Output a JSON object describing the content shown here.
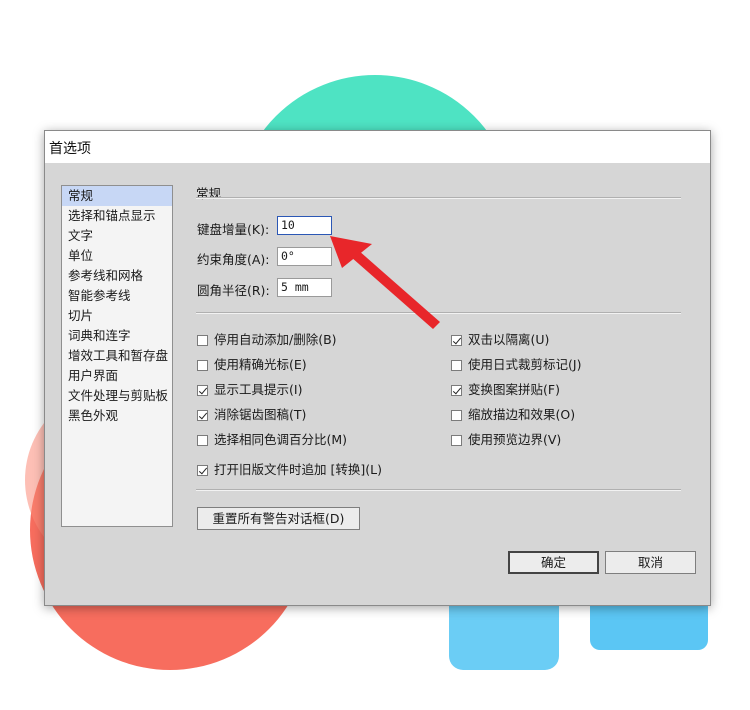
{
  "window": {
    "title": "首选项"
  },
  "sidebar": {
    "items": [
      {
        "label": "常规",
        "selected": true
      },
      {
        "label": "选择和锚点显示"
      },
      {
        "label": "文字"
      },
      {
        "label": "单位"
      },
      {
        "label": "参考线和网格"
      },
      {
        "label": "智能参考线"
      },
      {
        "label": "切片"
      },
      {
        "label": "词典和连字"
      },
      {
        "label": "增效工具和暂存盘"
      },
      {
        "label": "用户界面"
      },
      {
        "label": "文件处理与剪贴板"
      },
      {
        "label": "黑色外观"
      }
    ]
  },
  "general": {
    "section_title": "常规",
    "keyboard_increment": {
      "label": "键盘增量(K):",
      "value": "10"
    },
    "constrain_angle": {
      "label": "约束角度(A):",
      "value": "0°"
    },
    "corner_radius": {
      "label": "圆角半径(R):",
      "value": "5 mm"
    }
  },
  "options": {
    "disable_auto_add_delete": {
      "label": "停用自动添加/删除(B)",
      "checked": false
    },
    "double_click_isolate": {
      "label": "双击以隔离(U)",
      "checked": true
    },
    "precise_cursors": {
      "label": "使用精确光标(E)",
      "checked": false
    },
    "japanese_crop_marks": {
      "label": "使用日式裁剪标记(J)",
      "checked": false
    },
    "show_tooltips": {
      "label": "显示工具提示(I)",
      "checked": true
    },
    "transform_pattern_tiles": {
      "label": "变换图案拼贴(F)",
      "checked": true
    },
    "anti_aliased_artwork": {
      "label": "消除锯齿图稿(T)",
      "checked": true
    },
    "scale_strokes_effects": {
      "label": "缩放描边和效果(O)",
      "checked": false
    },
    "select_same_tint": {
      "label": "选择相同色调百分比(M)",
      "checked": false
    },
    "use_preview_bounds": {
      "label": "使用预览边界(V)",
      "checked": false
    },
    "append_converted": {
      "label": "打开旧版文件时追加 [转换](L)",
      "checked": true
    }
  },
  "buttons": {
    "reset_warnings": "重置所有警告对话框(D)",
    "ok": "确定",
    "cancel": "取消"
  },
  "colors": {
    "annotation_arrow": "#e8262a",
    "selection": "#c7d7f5",
    "dialog_bg": "#d6d6d6"
  }
}
